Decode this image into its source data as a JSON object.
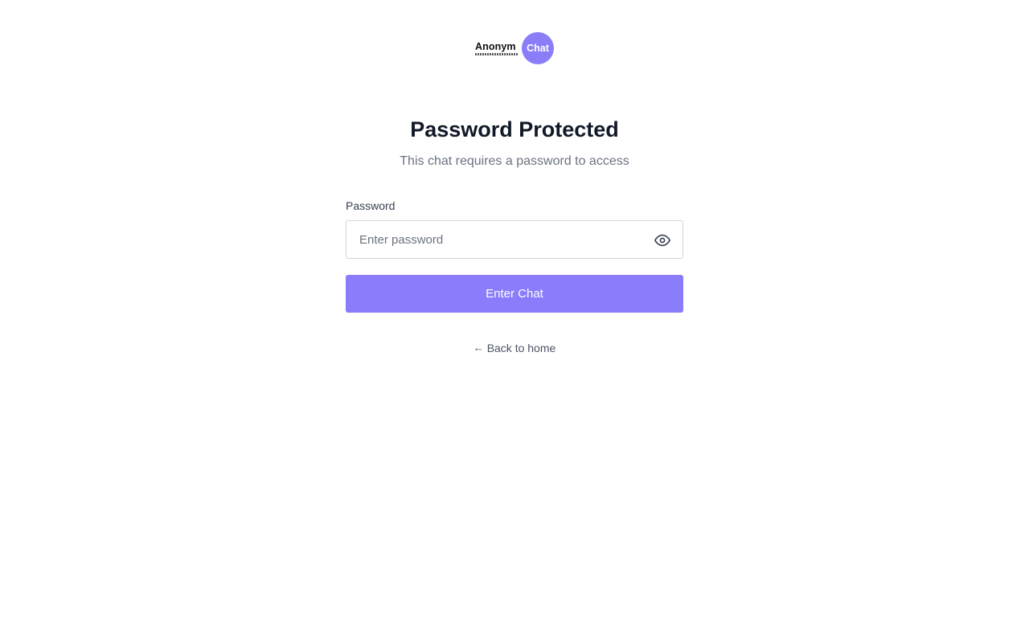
{
  "logo": {
    "wordmark": "Anonym",
    "badge": "Chat"
  },
  "header": {
    "title": "Password Protected",
    "subtitle": "This chat requires a password to access"
  },
  "form": {
    "password_label": "Password",
    "password_placeholder": "Enter password",
    "password_value": "",
    "toggle_icon": "eye-icon",
    "submit_label": "Enter Chat"
  },
  "footer": {
    "back_arrow": "←",
    "back_label": "Back to home"
  },
  "colors": {
    "accent": "#8b7cfb",
    "title": "#111827",
    "muted": "#6b7280",
    "border": "#d1d5db"
  }
}
